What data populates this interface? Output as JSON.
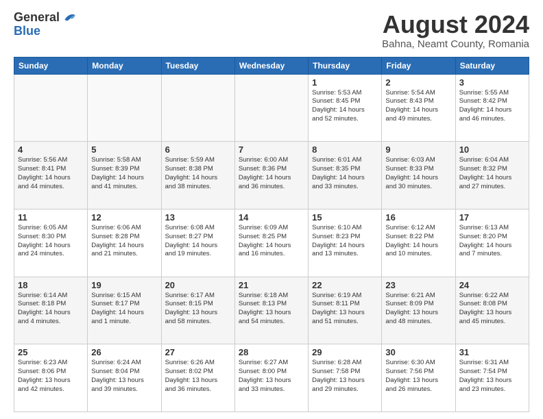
{
  "logo": {
    "general": "General",
    "blue": "Blue"
  },
  "title": {
    "month_year": "August 2024",
    "location": "Bahna, Neamt County, Romania"
  },
  "weekdays": [
    "Sunday",
    "Monday",
    "Tuesday",
    "Wednesday",
    "Thursday",
    "Friday",
    "Saturday"
  ],
  "weeks": [
    [
      {
        "day": "",
        "info": ""
      },
      {
        "day": "",
        "info": ""
      },
      {
        "day": "",
        "info": ""
      },
      {
        "day": "",
        "info": ""
      },
      {
        "day": "1",
        "info": "Sunrise: 5:53 AM\nSunset: 8:45 PM\nDaylight: 14 hours\nand 52 minutes."
      },
      {
        "day": "2",
        "info": "Sunrise: 5:54 AM\nSunset: 8:43 PM\nDaylight: 14 hours\nand 49 minutes."
      },
      {
        "day": "3",
        "info": "Sunrise: 5:55 AM\nSunset: 8:42 PM\nDaylight: 14 hours\nand 46 minutes."
      }
    ],
    [
      {
        "day": "4",
        "info": "Sunrise: 5:56 AM\nSunset: 8:41 PM\nDaylight: 14 hours\nand 44 minutes."
      },
      {
        "day": "5",
        "info": "Sunrise: 5:58 AM\nSunset: 8:39 PM\nDaylight: 14 hours\nand 41 minutes."
      },
      {
        "day": "6",
        "info": "Sunrise: 5:59 AM\nSunset: 8:38 PM\nDaylight: 14 hours\nand 38 minutes."
      },
      {
        "day": "7",
        "info": "Sunrise: 6:00 AM\nSunset: 8:36 PM\nDaylight: 14 hours\nand 36 minutes."
      },
      {
        "day": "8",
        "info": "Sunrise: 6:01 AM\nSunset: 8:35 PM\nDaylight: 14 hours\nand 33 minutes."
      },
      {
        "day": "9",
        "info": "Sunrise: 6:03 AM\nSunset: 8:33 PM\nDaylight: 14 hours\nand 30 minutes."
      },
      {
        "day": "10",
        "info": "Sunrise: 6:04 AM\nSunset: 8:32 PM\nDaylight: 14 hours\nand 27 minutes."
      }
    ],
    [
      {
        "day": "11",
        "info": "Sunrise: 6:05 AM\nSunset: 8:30 PM\nDaylight: 14 hours\nand 24 minutes."
      },
      {
        "day": "12",
        "info": "Sunrise: 6:06 AM\nSunset: 8:28 PM\nDaylight: 14 hours\nand 21 minutes."
      },
      {
        "day": "13",
        "info": "Sunrise: 6:08 AM\nSunset: 8:27 PM\nDaylight: 14 hours\nand 19 minutes."
      },
      {
        "day": "14",
        "info": "Sunrise: 6:09 AM\nSunset: 8:25 PM\nDaylight: 14 hours\nand 16 minutes."
      },
      {
        "day": "15",
        "info": "Sunrise: 6:10 AM\nSunset: 8:23 PM\nDaylight: 14 hours\nand 13 minutes."
      },
      {
        "day": "16",
        "info": "Sunrise: 6:12 AM\nSunset: 8:22 PM\nDaylight: 14 hours\nand 10 minutes."
      },
      {
        "day": "17",
        "info": "Sunrise: 6:13 AM\nSunset: 8:20 PM\nDaylight: 14 hours\nand 7 minutes."
      }
    ],
    [
      {
        "day": "18",
        "info": "Sunrise: 6:14 AM\nSunset: 8:18 PM\nDaylight: 14 hours\nand 4 minutes."
      },
      {
        "day": "19",
        "info": "Sunrise: 6:15 AM\nSunset: 8:17 PM\nDaylight: 14 hours\nand 1 minute."
      },
      {
        "day": "20",
        "info": "Sunrise: 6:17 AM\nSunset: 8:15 PM\nDaylight: 13 hours\nand 58 minutes."
      },
      {
        "day": "21",
        "info": "Sunrise: 6:18 AM\nSunset: 8:13 PM\nDaylight: 13 hours\nand 54 minutes."
      },
      {
        "day": "22",
        "info": "Sunrise: 6:19 AM\nSunset: 8:11 PM\nDaylight: 13 hours\nand 51 minutes."
      },
      {
        "day": "23",
        "info": "Sunrise: 6:21 AM\nSunset: 8:09 PM\nDaylight: 13 hours\nand 48 minutes."
      },
      {
        "day": "24",
        "info": "Sunrise: 6:22 AM\nSunset: 8:08 PM\nDaylight: 13 hours\nand 45 minutes."
      }
    ],
    [
      {
        "day": "25",
        "info": "Sunrise: 6:23 AM\nSunset: 8:06 PM\nDaylight: 13 hours\nand 42 minutes."
      },
      {
        "day": "26",
        "info": "Sunrise: 6:24 AM\nSunset: 8:04 PM\nDaylight: 13 hours\nand 39 minutes."
      },
      {
        "day": "27",
        "info": "Sunrise: 6:26 AM\nSunset: 8:02 PM\nDaylight: 13 hours\nand 36 minutes."
      },
      {
        "day": "28",
        "info": "Sunrise: 6:27 AM\nSunset: 8:00 PM\nDaylight: 13 hours\nand 33 minutes."
      },
      {
        "day": "29",
        "info": "Sunrise: 6:28 AM\nSunset: 7:58 PM\nDaylight: 13 hours\nand 29 minutes."
      },
      {
        "day": "30",
        "info": "Sunrise: 6:30 AM\nSunset: 7:56 PM\nDaylight: 13 hours\nand 26 minutes."
      },
      {
        "day": "31",
        "info": "Sunrise: 6:31 AM\nSunset: 7:54 PM\nDaylight: 13 hours\nand 23 minutes."
      }
    ]
  ]
}
